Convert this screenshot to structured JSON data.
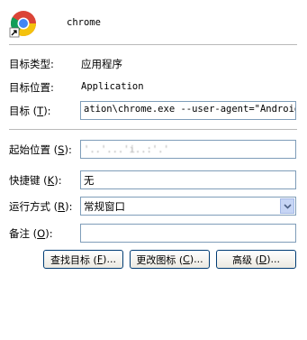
{
  "app": {
    "name": "chrome"
  },
  "fields": [
    {
      "label_prefix": "目标类型",
      "label_key": "",
      "label_suffix": ":",
      "value": "应用程序"
    },
    {
      "label_prefix": "目标位置",
      "label_key": "",
      "label_suffix": ":",
      "value": "Application"
    }
  ],
  "target": {
    "label_prefix": "目标 (",
    "label_key": "T",
    "label_suffix": "):",
    "value": "ation\\chrome.exe --user-agent=\"Android\""
  },
  "start_in": {
    "label_prefix": "起始位置 (",
    "label_key": "S",
    "label_suffix": "):",
    "value": "'..'...'i..:'.'"
  },
  "shortcut_key": {
    "label_prefix": "快捷键 (",
    "label_key": "K",
    "label_suffix": "):",
    "value": "无"
  },
  "run": {
    "label_prefix": "运行方式 (",
    "label_key": "R",
    "label_suffix": "):",
    "value": "常规窗口"
  },
  "comment": {
    "label_prefix": "备注 (",
    "label_key": "O",
    "label_suffix": "):",
    "value": ""
  },
  "buttons": {
    "find_target": {
      "prefix": "查找目标 (",
      "key": "F",
      "suffix": ")..."
    },
    "change_icon": {
      "prefix": "更改图标 (",
      "key": "C",
      "suffix": ")..."
    },
    "advanced": {
      "prefix": "高级 (",
      "key": "D",
      "suffix": ")..."
    }
  }
}
